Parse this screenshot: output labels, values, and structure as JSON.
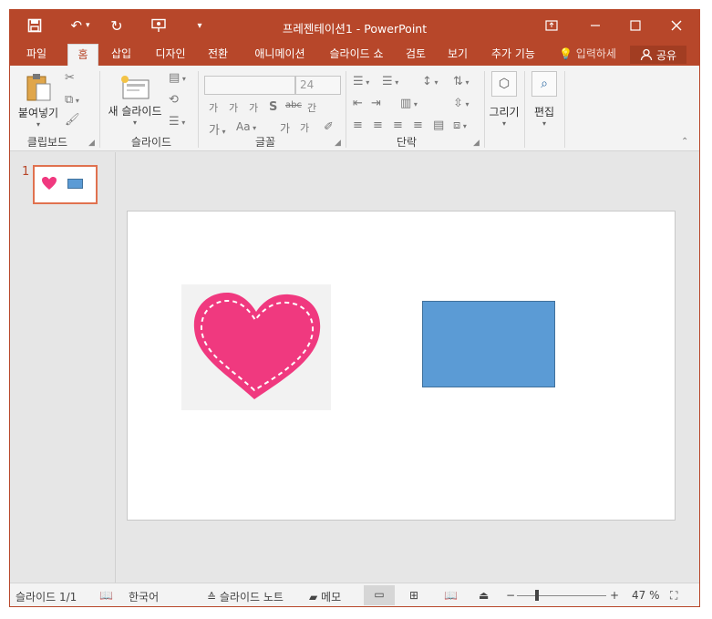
{
  "titlebar": {
    "title": "프레젠테이션1 - PowerPoint",
    "save_icon": "save-icon",
    "undo_icon": "undo-icon",
    "redo_icon": "redo-icon",
    "present_icon": "present-from-start-icon",
    "customize_icon": "customize-toolbar-icon",
    "controls": {
      "ribbon": "▣",
      "minimize": "—",
      "maximize": "☐",
      "close": "✕"
    }
  },
  "tabs": [
    "파일",
    "홈",
    "삽입",
    "디자인",
    "전환",
    "애니메이션",
    "슬라이드 쇼",
    "검토",
    "보기",
    "추가 기능"
  ],
  "active_tab": "홈",
  "search_placeholder": "입력하세",
  "share_label": "공유",
  "ribbon": {
    "clipboard": {
      "label": "클립보드",
      "paste": "붙여넣기"
    },
    "slides": {
      "label": "슬라이드",
      "new_slide": "새 슬라이드"
    },
    "font": {
      "label": "글꼴",
      "font_name": "",
      "font_size": "24"
    },
    "paragraph": {
      "label": "단락"
    },
    "drawing": {
      "draw": "그리기",
      "edit": "편집"
    }
  },
  "thumbnail": {
    "number": "1"
  },
  "status": {
    "slide_info": "슬라이드 1/1",
    "language": "한국어",
    "notes": "슬라이드 노트",
    "comments": "메모",
    "zoom": "47 %"
  },
  "colors": {
    "accent": "#b7472a",
    "heart": "#f0397f",
    "rectangle": "#5b9bd5"
  }
}
